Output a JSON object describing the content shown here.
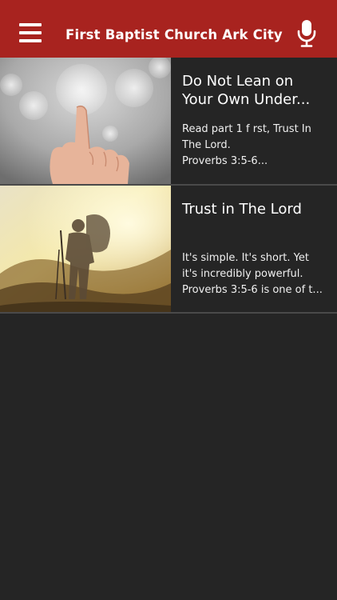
{
  "header": {
    "title": "First Baptist Church Ark City",
    "menu_icon": "hamburger-menu-icon",
    "mic_icon": "microphone-icon",
    "background_color": "#a8231f"
  },
  "list": {
    "items": [
      {
        "title_line1": "Do Not Lean on",
        "title_line2": "Your Own Under...",
        "desc_line1": "Read part 1 f rst, Trust In",
        "desc_line2": "The Lord.",
        "desc_line3": "Proverbs 3:5-6..."
      },
      {
        "title_line1": "Trust in The Lord",
        "title_line2": "",
        "desc_line1": "It's simple. It's short. Yet",
        "desc_line2": "it's incredibly powerful.",
        "desc_line3": "Proverbs 3:5-6 is one of t..."
      }
    ]
  },
  "colors": {
    "background": "#252525",
    "divider": "#4a4a4a",
    "text": "#ffffff"
  }
}
